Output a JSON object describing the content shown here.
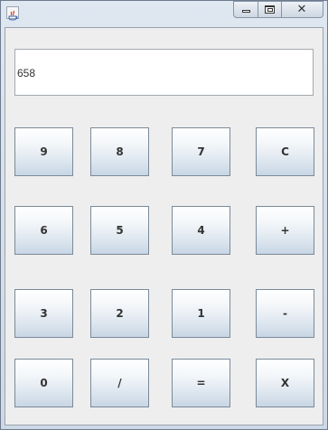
{
  "window": {
    "controls": {
      "close_glyph": "✕"
    }
  },
  "display": {
    "value": "658"
  },
  "keys": {
    "nine": "9",
    "eight": "8",
    "seven": "7",
    "clear": "C",
    "six": "6",
    "five": "5",
    "four": "4",
    "plus": "+",
    "three": "3",
    "two": "2",
    "one": "1",
    "minus": "-",
    "zero": "0",
    "divide": "/",
    "equals": "=",
    "multiply": "X"
  }
}
